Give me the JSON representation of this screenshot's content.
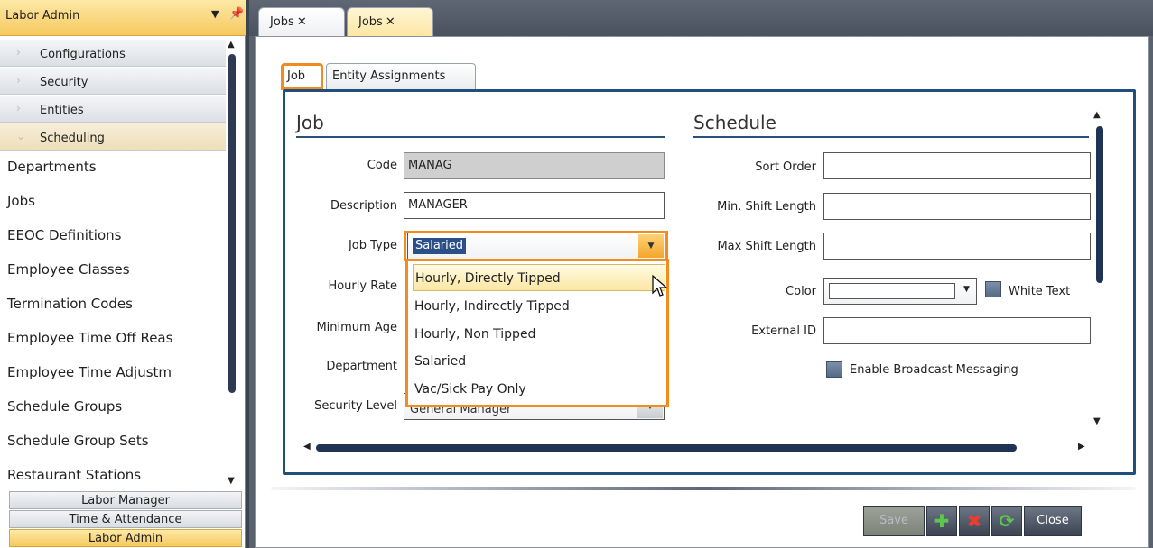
{
  "left_panel": {
    "title": "Labor Admin",
    "categories": [
      {
        "label": "Configurations"
      },
      {
        "label": "Security"
      },
      {
        "label": "Entities"
      },
      {
        "label": "Scheduling"
      }
    ],
    "items": [
      "Departments",
      "Jobs",
      "EEOC Definitions",
      "Employee Classes",
      "Termination Codes",
      "Employee Time Off Reas",
      "Employee Time Adjustm",
      "Schedule Groups",
      "Schedule Group Sets",
      "Restaurant Stations"
    ],
    "bottom_tabs": [
      "Labor Manager",
      "Time & Attendance",
      "Labor Admin"
    ]
  },
  "doc_tabs": [
    {
      "label": "Jobs"
    },
    {
      "label": "Jobs"
    }
  ],
  "sub_tabs": [
    {
      "label": "Job"
    },
    {
      "label": "Entity Assignments"
    }
  ],
  "job_section": {
    "title": "Job",
    "code_label": "Code",
    "code_value": "MANAG",
    "description_label": "Description",
    "description_value": "MANAGER",
    "job_type_label": "Job Type",
    "job_type_value": "Salaried",
    "hourly_rate_label": "Hourly Rate",
    "minimum_age_label": "Minimum Age",
    "department_label": "Department",
    "security_level_label": "Security Level",
    "security_level_value": "General Manager"
  },
  "job_type_options": [
    "Hourly, Directly Tipped",
    "Hourly, Indirectly Tipped",
    "Hourly, Non Tipped",
    "Salaried",
    "Vac/Sick Pay Only"
  ],
  "schedule_section": {
    "title": "Schedule",
    "sort_order_label": "Sort Order",
    "min_shift_label": "Min. Shift Length",
    "max_shift_label": "Max Shift Length",
    "color_label": "Color",
    "white_text_label": "White Text",
    "external_id_label": "External ID",
    "broadcast_label": "Enable Broadcast Messaging"
  },
  "toolbar": {
    "save_label": "Save",
    "close_label": "Close"
  },
  "colors": {
    "accent_orange": "#f28c1e",
    "panel_header_gold": "#f6c95f",
    "frame_blue": "#1f4f7a",
    "add_green": "#3fa33a",
    "delete_red": "#e23b2f"
  }
}
